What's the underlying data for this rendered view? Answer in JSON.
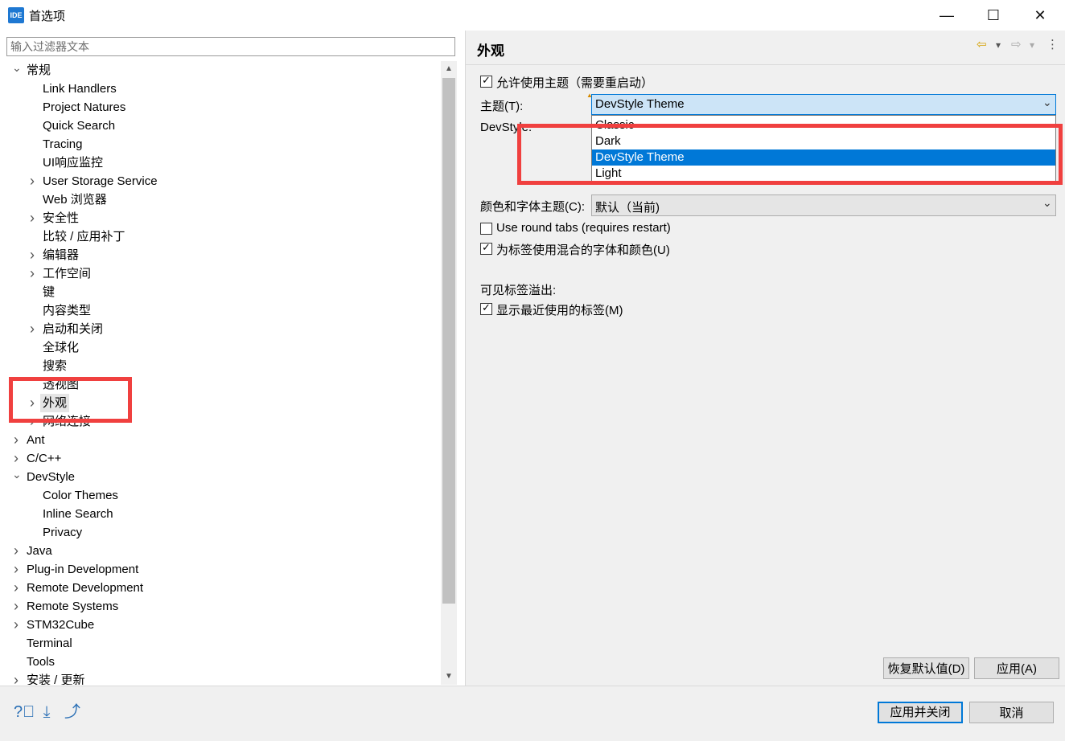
{
  "window": {
    "title": "首选项",
    "logo_text": "IDE",
    "controls": {
      "minimize": "—",
      "maximize": "☐",
      "close": "✕"
    }
  },
  "filter": {
    "placeholder": "输入过滤器文本"
  },
  "tree": {
    "items": [
      {
        "label": "常规",
        "level": 0,
        "chevron": "down"
      },
      {
        "label": "Link Handlers",
        "level": 1,
        "chevron": "none"
      },
      {
        "label": "Project Natures",
        "level": 1,
        "chevron": "none"
      },
      {
        "label": "Quick Search",
        "level": 1,
        "chevron": "none"
      },
      {
        "label": "Tracing",
        "level": 1,
        "chevron": "none"
      },
      {
        "label": "UI响应监控",
        "level": 1,
        "chevron": "none"
      },
      {
        "label": "User Storage Service",
        "level": 1,
        "chevron": "right"
      },
      {
        "label": "Web 浏览器",
        "level": 1,
        "chevron": "none"
      },
      {
        "label": "安全性",
        "level": 1,
        "chevron": "right"
      },
      {
        "label": "比较 / 应用补丁",
        "level": 1,
        "chevron": "none"
      },
      {
        "label": "编辑器",
        "level": 1,
        "chevron": "right"
      },
      {
        "label": "工作空间",
        "level": 1,
        "chevron": "right"
      },
      {
        "label": "键",
        "level": 1,
        "chevron": "none"
      },
      {
        "label": "内容类型",
        "level": 1,
        "chevron": "none"
      },
      {
        "label": "启动和关闭",
        "level": 1,
        "chevron": "right"
      },
      {
        "label": "全球化",
        "level": 1,
        "chevron": "none"
      },
      {
        "label": "搜索",
        "level": 1,
        "chevron": "none"
      },
      {
        "label": "透视图",
        "level": 1,
        "chevron": "none"
      },
      {
        "label": "外观",
        "level": 1,
        "chevron": "right",
        "selected": true
      },
      {
        "label": "网络连接",
        "level": 1,
        "chevron": "right"
      },
      {
        "label": "Ant",
        "level": 0,
        "chevron": "right"
      },
      {
        "label": "C/C++",
        "level": 0,
        "chevron": "right"
      },
      {
        "label": "DevStyle",
        "level": 0,
        "chevron": "down"
      },
      {
        "label": "Color Themes",
        "level": 1,
        "chevron": "none"
      },
      {
        "label": "Inline Search",
        "level": 1,
        "chevron": "none"
      },
      {
        "label": "Privacy",
        "level": 1,
        "chevron": "none"
      },
      {
        "label": "Java",
        "level": 0,
        "chevron": "right"
      },
      {
        "label": "Plug-in Development",
        "level": 0,
        "chevron": "right"
      },
      {
        "label": "Remote Development",
        "level": 0,
        "chevron": "right"
      },
      {
        "label": "Remote Systems",
        "level": 0,
        "chevron": "right"
      },
      {
        "label": "STM32Cube",
        "level": 0,
        "chevron": "right"
      },
      {
        "label": "Terminal",
        "level": 0,
        "chevron": "none"
      },
      {
        "label": "Tools",
        "level": 0,
        "chevron": "none"
      },
      {
        "label": "安装 / 更新",
        "level": 0,
        "chevron": "right"
      }
    ]
  },
  "page": {
    "title": "外观",
    "nav": {
      "back": "⇦",
      "forward": "⇨",
      "menu": "⋮",
      "dropdown": "▾"
    },
    "enable_theme": {
      "label": "允许使用主题（需要重启动）",
      "checked": true
    },
    "theme": {
      "label": "主题(T):",
      "value": "DevStyle Theme",
      "options": [
        "Classic",
        "Dark",
        "DevStyle Theme",
        "Light"
      ],
      "selected_index": 2
    },
    "devstyle_label": "DevStyle:",
    "color_font_theme": {
      "label": "颜色和字体主题(C):",
      "value": "默认（当前)"
    },
    "round_tabs": {
      "label": "Use round tabs (requires restart)",
      "checked": false
    },
    "mixed_fonts": {
      "label": "为标签使用混合的字体和颜色(U)",
      "checked": true
    },
    "tab_overflow_label": "可见标签溢出:",
    "show_recent": {
      "label": "显示最近使用的标签(M)",
      "checked": true
    },
    "buttons": {
      "restore_defaults": "恢复默认值(D)",
      "apply": "应用(A)"
    }
  },
  "footer": {
    "icons": [
      "help-icon",
      "import-icon",
      "export-icon"
    ],
    "buttons": {
      "apply_close": "应用并关闭",
      "cancel": "取消"
    }
  },
  "colors": {
    "accent": "#0078d7",
    "highlight_box": "#f0403f"
  }
}
